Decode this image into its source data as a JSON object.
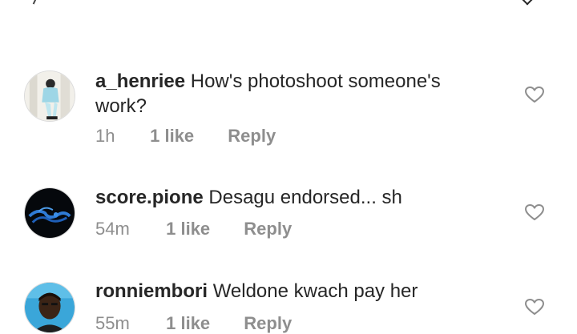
{
  "comments": [
    {
      "username": "a_henriee",
      "text": "How's photoshoot someone's work?",
      "time": "1h",
      "likes": "1 like",
      "reply": "Reply"
    },
    {
      "username": "score.pione",
      "text": "Desagu  endorsed... sh",
      "time": "54m",
      "likes": "1 like",
      "reply": "Reply"
    },
    {
      "username": "ronniembori",
      "text": "Weldone kwach pay her",
      "time": "55m",
      "likes": "1 like",
      "reply": "Reply"
    }
  ],
  "icons": {
    "like": "heart-outline-icon"
  },
  "colors": {
    "text": "#262626",
    "meta": "#8e8e8e"
  }
}
